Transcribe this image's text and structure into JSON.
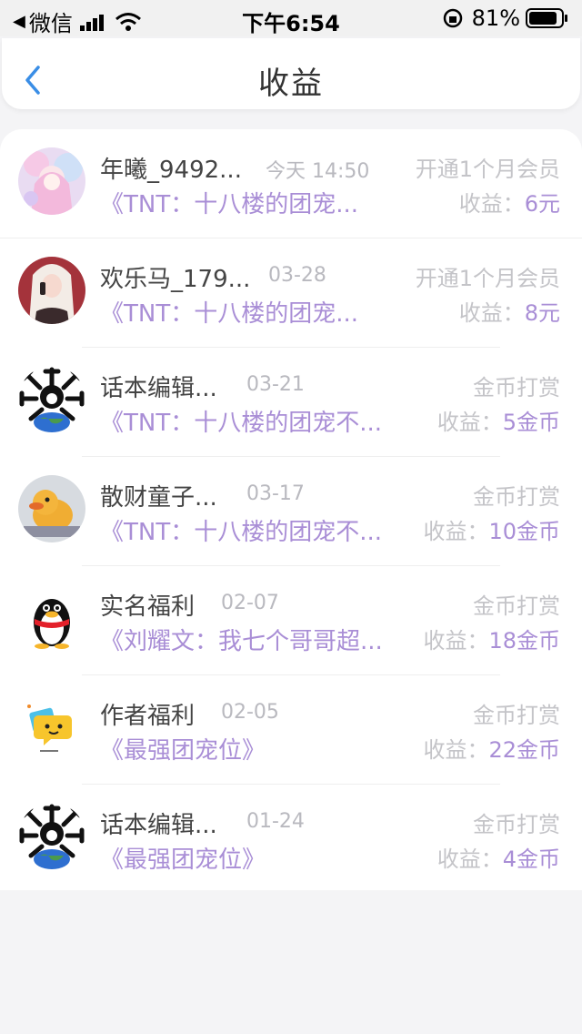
{
  "status": {
    "back_app": "微信",
    "time": "下午6:54",
    "battery": "81%"
  },
  "header": {
    "title": "收益"
  },
  "items": [
    {
      "name": "年曦_9492...",
      "date": "今天 14:50",
      "type": "开通1个月会员",
      "book": "《TNT：十八楼的团宠...",
      "income_label": "收益：",
      "income_value": "6元",
      "avatar": "anime-girl-avatar"
    },
    {
      "name": "欢乐马_179...",
      "date": "03-28",
      "type": "开通1个月会员",
      "book": "《TNT：十八楼的团宠...",
      "income_label": "收益：",
      "income_value": "8元",
      "avatar": "woman-phone-avatar"
    },
    {
      "name": "话本编辑...",
      "date": "03-21",
      "type": "金币打赏",
      "book": "《TNT：十八楼的团宠不...",
      "income_label": "收益：",
      "income_value": "5金币",
      "avatar": "editor-globe-avatar"
    },
    {
      "name": "散财童子...",
      "date": "03-17",
      "type": "金币打赏",
      "book": "《TNT：十八楼的团宠不...",
      "income_label": "收益：",
      "income_value": "10金币",
      "avatar": "duck-avatar"
    },
    {
      "name": "实名福利",
      "date": "02-07",
      "type": "金币打赏",
      "book": "《刘耀文：我七个哥哥超...",
      "income_label": "收益：",
      "income_value": "18金币",
      "avatar": "penguin-avatar"
    },
    {
      "name": "作者福利",
      "date": "02-05",
      "type": "金币打赏",
      "book": "《最强团宠位》",
      "income_label": "收益：",
      "income_value": "22金币",
      "avatar": "chat-bubble-avatar"
    },
    {
      "name": "话本编辑...",
      "date": "01-24",
      "type": "金币打赏",
      "book": "《最强团宠位》",
      "income_label": "收益：",
      "income_value": "4金币",
      "avatar": "editor-globe-avatar"
    }
  ],
  "colors": {
    "accent": "#a98ed6",
    "muted": "#c4c4c8",
    "back": "#3a8ee6"
  }
}
